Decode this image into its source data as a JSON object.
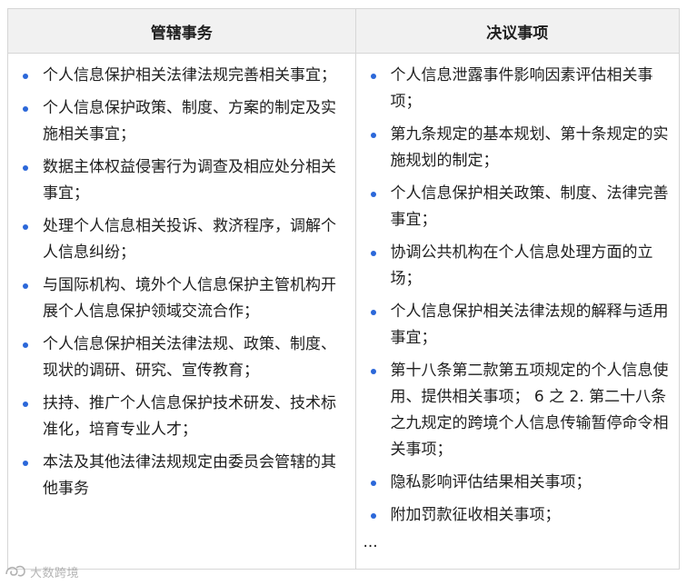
{
  "table": {
    "headers": [
      "管辖事务",
      "决议事项"
    ],
    "left_items": [
      "个人信息保护相关法律法规完善相关事宜；",
      "个人信息保护政策、制度、方案的制定及实施相关事宜；",
      "数据主体权益侵害行为调查及相应处分相关事宜；",
      "处理个人信息相关投诉、救济程序，调解个人信息纠纷；",
      "与国际机构、境外个人信息保护主管机构开展个人信息保护领域交流合作；",
      "个人信息保护相关法律法规、政策、制度、现状的调研、研究、宣传教育；",
      "扶持、推广个人信息保护技术研发、技术标准化，培育专业人才；",
      "本法及其他法律法规规定由委员会管辖的其他事务"
    ],
    "right_items": [
      "个人信息泄露事件影响因素评估相关事项；",
      "第九条规定的基本规划、第十条规定的实施规划的制定；",
      "个人信息保护相关政策、制度、法律完善事宜；",
      "协调公共机构在个人信息处理方面的立场；",
      "个人信息保护相关法律法规的解释与适用事宜；",
      "第十八条第二款第五项规定的个人信息使用、提供相关事项； 6 之 2. 第二十八条之九规定的跨境个人信息传输暂停命令相关事项；",
      "隐私影响评估结果相关事项；",
      "附加罚款征收相关事项；"
    ],
    "ellipsis": "..."
  },
  "watermark": {
    "text": "大数跨境",
    "icon": "watermark-logo-icon"
  },
  "colors": {
    "bullet": "#2b67d9",
    "header_bg": "#f1f1f1",
    "border": "#d6d6d6",
    "text": "#1f1f1f"
  }
}
